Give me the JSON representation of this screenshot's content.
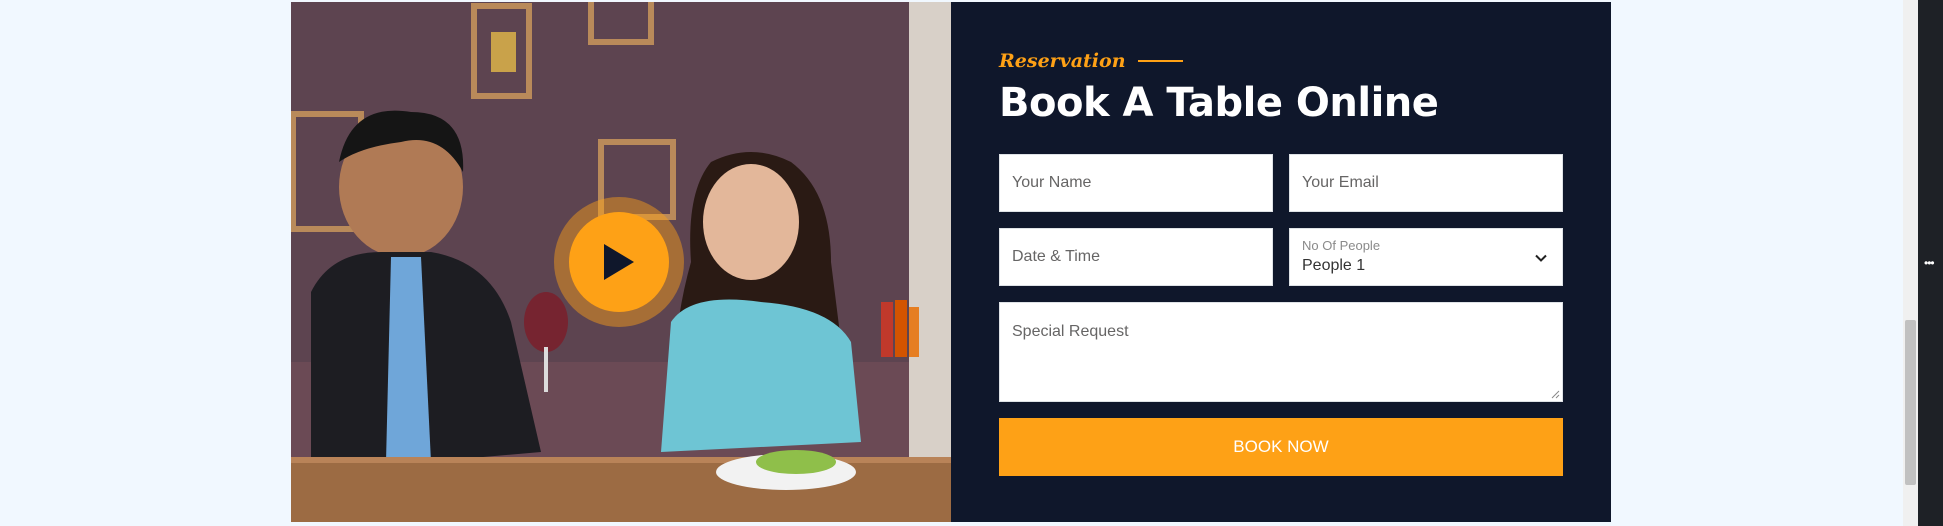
{
  "reservation": {
    "subtitle": "Reservation",
    "title": "Book A Table Online",
    "fields": {
      "name_placeholder": "Your Name",
      "email_placeholder": "Your Email",
      "datetime_placeholder": "Date & Time",
      "people_label": "No Of People",
      "people_value": "People 1",
      "request_placeholder": "Special Request"
    },
    "submit_label": "BOOK NOW"
  },
  "video": {
    "play_icon": "play-icon"
  },
  "devtools": {
    "menu_icon": "ellipsis-icon"
  },
  "colors": {
    "accent": "#fea116",
    "dark": "#0f172b",
    "page_background": "#f1f8ff"
  }
}
